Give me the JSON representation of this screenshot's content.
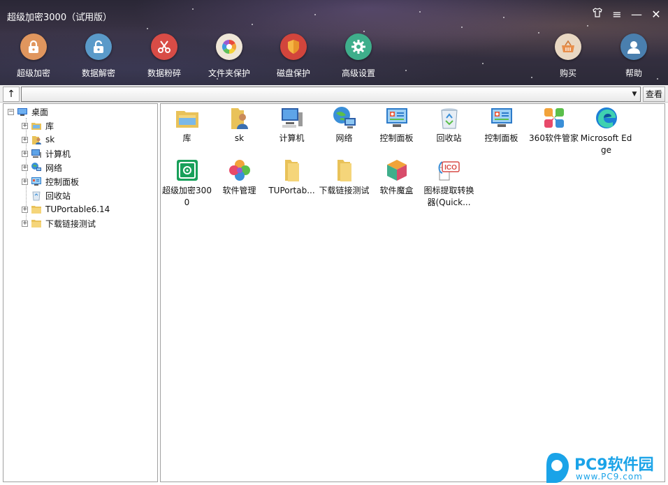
{
  "window": {
    "title": "超级加密3000（试用版）"
  },
  "toolbar": [
    {
      "label": "超级加密",
      "icon": "lock-icon",
      "color": "#e0965e"
    },
    {
      "label": "数据解密",
      "icon": "unlock-icon",
      "color": "#5a9ac9"
    },
    {
      "label": "数据粉碎",
      "icon": "scissors-icon",
      "color": "#d84c46"
    },
    {
      "label": "文件夹保护",
      "icon": "aperture-icon",
      "color": "#efe6d7"
    },
    {
      "label": "磁盘保护",
      "icon": "shield-icon",
      "color": "#d2453c"
    },
    {
      "label": "高级设置",
      "icon": "gear-icon",
      "color": "#3fae8b"
    },
    {
      "label": "购买",
      "icon": "basket-icon",
      "color": "#e9d8c3"
    },
    {
      "label": "帮助",
      "icon": "user-icon",
      "color": "#4a7fae"
    }
  ],
  "address": {
    "value": "",
    "view_button": "查看",
    "up_glyph": "↑"
  },
  "tree": {
    "root": "桌面",
    "items": [
      "库",
      "sk",
      "计算机",
      "网络",
      "控制面板",
      "回收站",
      "TUPortable6.14",
      "下载链接测试"
    ]
  },
  "grid": {
    "row1": [
      "库",
      "sk",
      "计算机",
      "网络",
      "控制面板",
      "回收站",
      "控制面板",
      "360软件管家",
      "Microsoft Edge"
    ],
    "row2": [
      "超级加密3000",
      "软件管理",
      "TUPortab...",
      "下载链接测试",
      "软件魔盒",
      "图标提取转换器(Quick..."
    ]
  },
  "watermark": {
    "title": "PC9软件园",
    "url": "www.PC9.com"
  }
}
